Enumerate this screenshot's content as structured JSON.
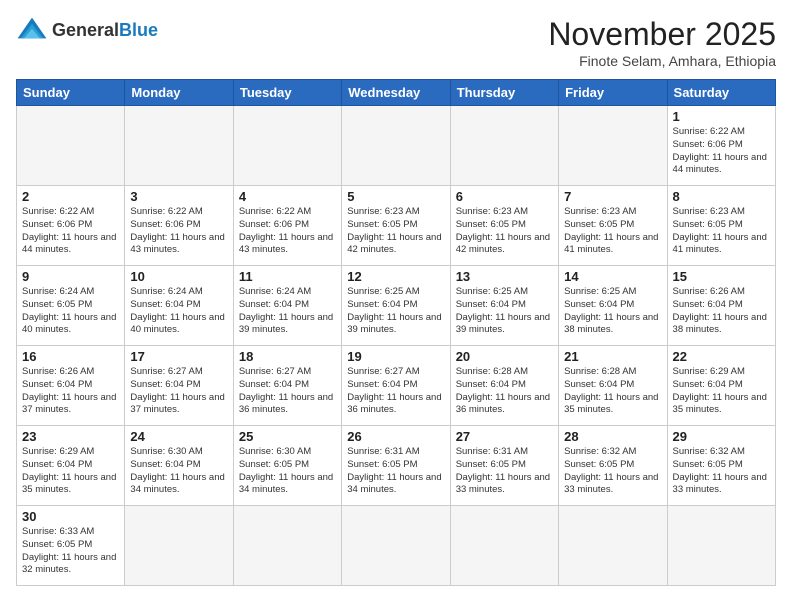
{
  "logo": {
    "general": "General",
    "blue": "Blue"
  },
  "title": "November 2025",
  "subtitle": "Finote Selam, Amhara, Ethiopia",
  "weekdays": [
    "Sunday",
    "Monday",
    "Tuesday",
    "Wednesday",
    "Thursday",
    "Friday",
    "Saturday"
  ],
  "weeks": [
    [
      {
        "day": "",
        "info": ""
      },
      {
        "day": "",
        "info": ""
      },
      {
        "day": "",
        "info": ""
      },
      {
        "day": "",
        "info": ""
      },
      {
        "day": "",
        "info": ""
      },
      {
        "day": "",
        "info": ""
      },
      {
        "day": "1",
        "info": "Sunrise: 6:22 AM\nSunset: 6:06 PM\nDaylight: 11 hours and 44 minutes."
      }
    ],
    [
      {
        "day": "2",
        "info": "Sunrise: 6:22 AM\nSunset: 6:06 PM\nDaylight: 11 hours and 44 minutes."
      },
      {
        "day": "3",
        "info": "Sunrise: 6:22 AM\nSunset: 6:06 PM\nDaylight: 11 hours and 43 minutes."
      },
      {
        "day": "4",
        "info": "Sunrise: 6:22 AM\nSunset: 6:06 PM\nDaylight: 11 hours and 43 minutes."
      },
      {
        "day": "5",
        "info": "Sunrise: 6:23 AM\nSunset: 6:05 PM\nDaylight: 11 hours and 42 minutes."
      },
      {
        "day": "6",
        "info": "Sunrise: 6:23 AM\nSunset: 6:05 PM\nDaylight: 11 hours and 42 minutes."
      },
      {
        "day": "7",
        "info": "Sunrise: 6:23 AM\nSunset: 6:05 PM\nDaylight: 11 hours and 41 minutes."
      },
      {
        "day": "8",
        "info": "Sunrise: 6:23 AM\nSunset: 6:05 PM\nDaylight: 11 hours and 41 minutes."
      }
    ],
    [
      {
        "day": "9",
        "info": "Sunrise: 6:24 AM\nSunset: 6:05 PM\nDaylight: 11 hours and 40 minutes."
      },
      {
        "day": "10",
        "info": "Sunrise: 6:24 AM\nSunset: 6:04 PM\nDaylight: 11 hours and 40 minutes."
      },
      {
        "day": "11",
        "info": "Sunrise: 6:24 AM\nSunset: 6:04 PM\nDaylight: 11 hours and 39 minutes."
      },
      {
        "day": "12",
        "info": "Sunrise: 6:25 AM\nSunset: 6:04 PM\nDaylight: 11 hours and 39 minutes."
      },
      {
        "day": "13",
        "info": "Sunrise: 6:25 AM\nSunset: 6:04 PM\nDaylight: 11 hours and 39 minutes."
      },
      {
        "day": "14",
        "info": "Sunrise: 6:25 AM\nSunset: 6:04 PM\nDaylight: 11 hours and 38 minutes."
      },
      {
        "day": "15",
        "info": "Sunrise: 6:26 AM\nSunset: 6:04 PM\nDaylight: 11 hours and 38 minutes."
      }
    ],
    [
      {
        "day": "16",
        "info": "Sunrise: 6:26 AM\nSunset: 6:04 PM\nDaylight: 11 hours and 37 minutes."
      },
      {
        "day": "17",
        "info": "Sunrise: 6:27 AM\nSunset: 6:04 PM\nDaylight: 11 hours and 37 minutes."
      },
      {
        "day": "18",
        "info": "Sunrise: 6:27 AM\nSunset: 6:04 PM\nDaylight: 11 hours and 36 minutes."
      },
      {
        "day": "19",
        "info": "Sunrise: 6:27 AM\nSunset: 6:04 PM\nDaylight: 11 hours and 36 minutes."
      },
      {
        "day": "20",
        "info": "Sunrise: 6:28 AM\nSunset: 6:04 PM\nDaylight: 11 hours and 36 minutes."
      },
      {
        "day": "21",
        "info": "Sunrise: 6:28 AM\nSunset: 6:04 PM\nDaylight: 11 hours and 35 minutes."
      },
      {
        "day": "22",
        "info": "Sunrise: 6:29 AM\nSunset: 6:04 PM\nDaylight: 11 hours and 35 minutes."
      }
    ],
    [
      {
        "day": "23",
        "info": "Sunrise: 6:29 AM\nSunset: 6:04 PM\nDaylight: 11 hours and 35 minutes."
      },
      {
        "day": "24",
        "info": "Sunrise: 6:30 AM\nSunset: 6:04 PM\nDaylight: 11 hours and 34 minutes."
      },
      {
        "day": "25",
        "info": "Sunrise: 6:30 AM\nSunset: 6:05 PM\nDaylight: 11 hours and 34 minutes."
      },
      {
        "day": "26",
        "info": "Sunrise: 6:31 AM\nSunset: 6:05 PM\nDaylight: 11 hours and 34 minutes."
      },
      {
        "day": "27",
        "info": "Sunrise: 6:31 AM\nSunset: 6:05 PM\nDaylight: 11 hours and 33 minutes."
      },
      {
        "day": "28",
        "info": "Sunrise: 6:32 AM\nSunset: 6:05 PM\nDaylight: 11 hours and 33 minutes."
      },
      {
        "day": "29",
        "info": "Sunrise: 6:32 AM\nSunset: 6:05 PM\nDaylight: 11 hours and 33 minutes."
      }
    ],
    [
      {
        "day": "30",
        "info": "Sunrise: 6:33 AM\nSunset: 6:05 PM\nDaylight: 11 hours and 32 minutes."
      },
      {
        "day": "",
        "info": ""
      },
      {
        "day": "",
        "info": ""
      },
      {
        "day": "",
        "info": ""
      },
      {
        "day": "",
        "info": ""
      },
      {
        "day": "",
        "info": ""
      },
      {
        "day": "",
        "info": ""
      }
    ]
  ]
}
